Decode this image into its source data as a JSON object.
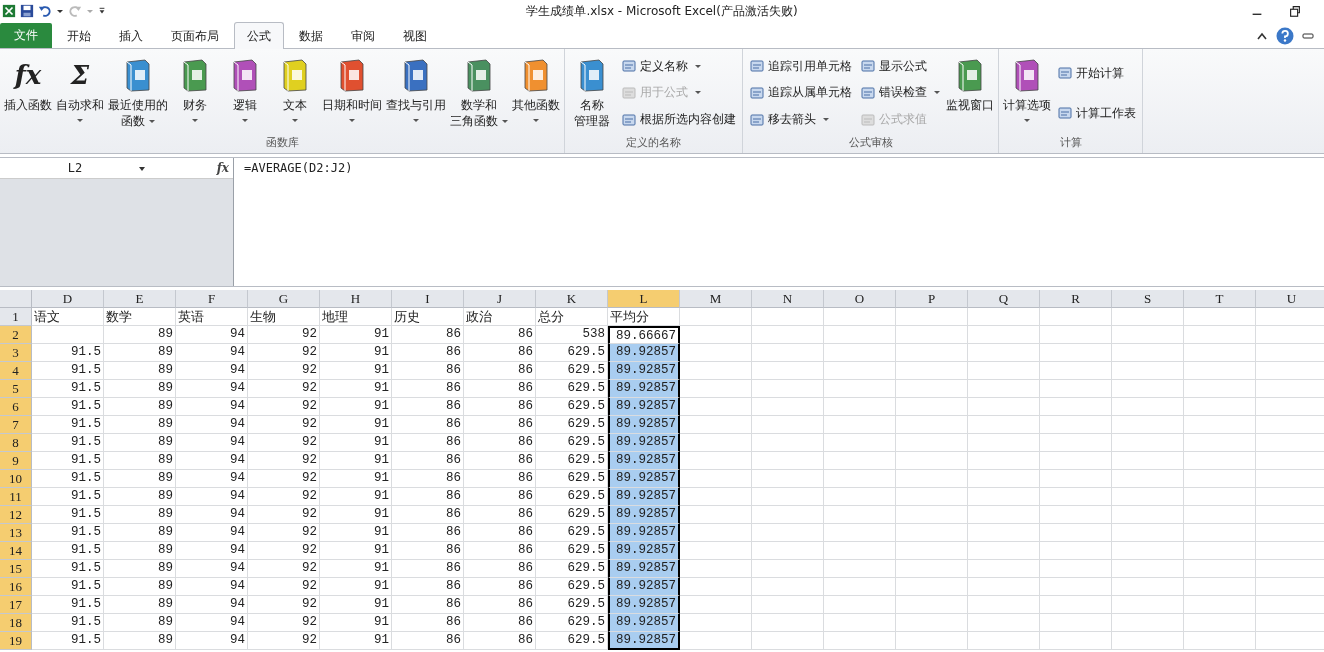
{
  "window": {
    "title": "学生成绩单.xlsx  -  Microsoft Excel(产品激活失败)"
  },
  "tabs": [
    {
      "label": "文件",
      "kind": "file",
      "selected": false
    },
    {
      "label": "开始",
      "kind": "tab",
      "selected": false
    },
    {
      "label": "插入",
      "kind": "tab",
      "selected": false
    },
    {
      "label": "页面布局",
      "kind": "tab",
      "selected": false
    },
    {
      "label": "公式",
      "kind": "tab",
      "selected": true
    },
    {
      "label": "数据",
      "kind": "tab",
      "selected": false
    },
    {
      "label": "审阅",
      "kind": "tab",
      "selected": false
    },
    {
      "label": "视图",
      "kind": "tab",
      "selected": false
    }
  ],
  "ribbon": {
    "groups": [
      {
        "label": "函数库",
        "columns": [
          {
            "kind": "large",
            "items": [
              {
                "glyph": "fx",
                "lines": [
                  "插入函数"
                ],
                "dropdown": false
              }
            ]
          },
          {
            "kind": "large",
            "items": [
              {
                "glyph": "Σ",
                "lines": [
                  "自动求和"
                ],
                "dropdown": true
              }
            ]
          },
          {
            "kind": "large",
            "items": [
              {
                "lines": [
                  "最近使用的",
                  "函数"
                ],
                "dropdown": true
              }
            ]
          },
          {
            "kind": "large",
            "items": [
              {
                "lines": [
                  "财务"
                ],
                "dropdown": true
              }
            ]
          },
          {
            "kind": "large",
            "items": [
              {
                "lines": [
                  "逻辑"
                ],
                "dropdown": true
              }
            ]
          },
          {
            "kind": "large",
            "items": [
              {
                "lines": [
                  "文本"
                ],
                "dropdown": true
              }
            ]
          },
          {
            "kind": "large",
            "items": [
              {
                "lines": [
                  "日期和时间"
                ],
                "dropdown": true
              }
            ]
          },
          {
            "kind": "large",
            "items": [
              {
                "lines": [
                  "查找与引用"
                ],
                "dropdown": true
              }
            ]
          },
          {
            "kind": "large",
            "items": [
              {
                "lines": [
                  "数学和",
                  "三角函数"
                ],
                "dropdown": true
              }
            ]
          },
          {
            "kind": "large",
            "items": [
              {
                "lines": [
                  "其他函数"
                ],
                "dropdown": true
              }
            ]
          }
        ]
      },
      {
        "label": "定义的名称",
        "columns": [
          {
            "kind": "large",
            "items": [
              {
                "lines": [
                  "名称",
                  "管理器"
                ],
                "dropdown": false
              }
            ]
          },
          {
            "kind": "stack",
            "items": [
              {
                "lines": [
                  "定义名称"
                ],
                "dropdown": true,
                "disabled": false
              },
              {
                "lines": [
                  "用于公式"
                ],
                "dropdown": true,
                "disabled": true
              },
              {
                "lines": [
                  "根据所选内容创建"
                ],
                "dropdown": false,
                "disabled": false
              }
            ]
          }
        ]
      },
      {
        "label": "公式审核",
        "columns": [
          {
            "kind": "stack",
            "items": [
              {
                "lines": [
                  "追踪引用单元格"
                ],
                "dropdown": false,
                "disabled": false
              },
              {
                "lines": [
                  "追踪从属单元格"
                ],
                "dropdown": false,
                "disabled": false
              },
              {
                "lines": [
                  "移去箭头"
                ],
                "dropdown": true,
                "disabled": false
              }
            ]
          },
          {
            "kind": "stack",
            "items": [
              {
                "lines": [
                  "显示公式"
                ],
                "dropdown": false,
                "disabled": false
              },
              {
                "lines": [
                  "错误检查"
                ],
                "dropdown": true,
                "disabled": false
              },
              {
                "lines": [
                  "公式求值"
                ],
                "dropdown": false,
                "disabled": true
              }
            ]
          },
          {
            "kind": "large",
            "items": [
              {
                "lines": [
                  "监视窗口"
                ],
                "dropdown": false
              }
            ]
          }
        ]
      },
      {
        "label": "计算",
        "columns": [
          {
            "kind": "large",
            "items": [
              {
                "lines": [
                  "计算选项"
                ],
                "dropdown": true
              }
            ]
          },
          {
            "kind": "stack",
            "items": [
              {
                "lines": [
                  "开始计算"
                ],
                "dropdown": false,
                "disabled": false
              },
              {
                "lines": [
                  "计算工作表"
                ],
                "dropdown": false,
                "disabled": false
              }
            ]
          }
        ]
      }
    ]
  },
  "formula_bar": {
    "name_box": "L2",
    "fx": "fx",
    "formula": "=AVERAGE(D2:J2)"
  },
  "columns": [
    {
      "label": "D",
      "selected": false
    },
    {
      "label": "E",
      "selected": false
    },
    {
      "label": "F",
      "selected": false
    },
    {
      "label": "G",
      "selected": false
    },
    {
      "label": "H",
      "selected": false
    },
    {
      "label": "I",
      "selected": false
    },
    {
      "label": "J",
      "selected": false
    },
    {
      "label": "K",
      "selected": false
    },
    {
      "label": "L",
      "selected": true
    },
    {
      "label": "M",
      "selected": false
    },
    {
      "label": "N",
      "selected": false
    },
    {
      "label": "O",
      "selected": false
    },
    {
      "label": "P",
      "selected": false
    },
    {
      "label": "Q",
      "selected": false
    },
    {
      "label": "R",
      "selected": false
    },
    {
      "label": "S",
      "selected": false
    },
    {
      "label": "T",
      "selected": false
    },
    {
      "label": "U",
      "selected": false
    }
  ],
  "rows": [
    {
      "number": "1",
      "kind": "text",
      "selected": false,
      "cells": [
        "语文",
        "数学",
        "英语",
        "生物",
        "地理",
        "历史",
        "政治",
        "总分",
        "平均分"
      ]
    },
    {
      "number": "2",
      "kind": "number",
      "selected": true,
      "cells": [
        null,
        "89",
        "94",
        "92",
        "91",
        "86",
        "86",
        "538",
        "89.66667"
      ]
    },
    {
      "number": "3",
      "kind": "number",
      "selected": true,
      "cells": [
        "91.5",
        "89",
        "94",
        "92",
        "91",
        "86",
        "86",
        "629.5",
        "89.92857"
      ]
    },
    {
      "number": "4",
      "kind": "number",
      "selected": true,
      "cells": [
        "91.5",
        "89",
        "94",
        "92",
        "91",
        "86",
        "86",
        "629.5",
        "89.92857"
      ]
    },
    {
      "number": "5",
      "kind": "number",
      "selected": true,
      "cells": [
        "91.5",
        "89",
        "94",
        "92",
        "91",
        "86",
        "86",
        "629.5",
        "89.92857"
      ]
    },
    {
      "number": "6",
      "kind": "number",
      "selected": true,
      "cells": [
        "91.5",
        "89",
        "94",
        "92",
        "91",
        "86",
        "86",
        "629.5",
        "89.92857"
      ]
    },
    {
      "number": "7",
      "kind": "number",
      "selected": true,
      "cells": [
        "91.5",
        "89",
        "94",
        "92",
        "91",
        "86",
        "86",
        "629.5",
        "89.92857"
      ]
    },
    {
      "number": "8",
      "kind": "number",
      "selected": true,
      "cells": [
        "91.5",
        "89",
        "94",
        "92",
        "91",
        "86",
        "86",
        "629.5",
        "89.92857"
      ]
    },
    {
      "number": "9",
      "kind": "number",
      "selected": true,
      "cells": [
        "91.5",
        "89",
        "94",
        "92",
        "91",
        "86",
        "86",
        "629.5",
        "89.92857"
      ]
    },
    {
      "number": "10",
      "kind": "number",
      "selected": true,
      "cells": [
        "91.5",
        "89",
        "94",
        "92",
        "91",
        "86",
        "86",
        "629.5",
        "89.92857"
      ]
    },
    {
      "number": "11",
      "kind": "number",
      "selected": true,
      "cells": [
        "91.5",
        "89",
        "94",
        "92",
        "91",
        "86",
        "86",
        "629.5",
        "89.92857"
      ]
    },
    {
      "number": "12",
      "kind": "number",
      "selected": true,
      "cells": [
        "91.5",
        "89",
        "94",
        "92",
        "91",
        "86",
        "86",
        "629.5",
        "89.92857"
      ]
    },
    {
      "number": "13",
      "kind": "number",
      "selected": true,
      "cells": [
        "91.5",
        "89",
        "94",
        "92",
        "91",
        "86",
        "86",
        "629.5",
        "89.92857"
      ]
    },
    {
      "number": "14",
      "kind": "number",
      "selected": true,
      "cells": [
        "91.5",
        "89",
        "94",
        "92",
        "91",
        "86",
        "86",
        "629.5",
        "89.92857"
      ]
    },
    {
      "number": "15",
      "kind": "number",
      "selected": true,
      "cells": [
        "91.5",
        "89",
        "94",
        "92",
        "91",
        "86",
        "86",
        "629.5",
        "89.92857"
      ]
    },
    {
      "number": "16",
      "kind": "number",
      "selected": true,
      "cells": [
        "91.5",
        "89",
        "94",
        "92",
        "91",
        "86",
        "86",
        "629.5",
        "89.92857"
      ]
    },
    {
      "number": "17",
      "kind": "number",
      "selected": true,
      "cells": [
        "91.5",
        "89",
        "94",
        "92",
        "91",
        "86",
        "86",
        "629.5",
        "89.92857"
      ]
    },
    {
      "number": "18",
      "kind": "number",
      "selected": true,
      "cells": [
        "91.5",
        "89",
        "94",
        "92",
        "91",
        "86",
        "86",
        "629.5",
        "89.92857"
      ]
    },
    {
      "number": "19",
      "kind": "number",
      "selected": true,
      "cells": [
        "91.5",
        "89",
        "94",
        "92",
        "91",
        "86",
        "86",
        "629.5",
        "89.92857"
      ]
    }
  ]
}
